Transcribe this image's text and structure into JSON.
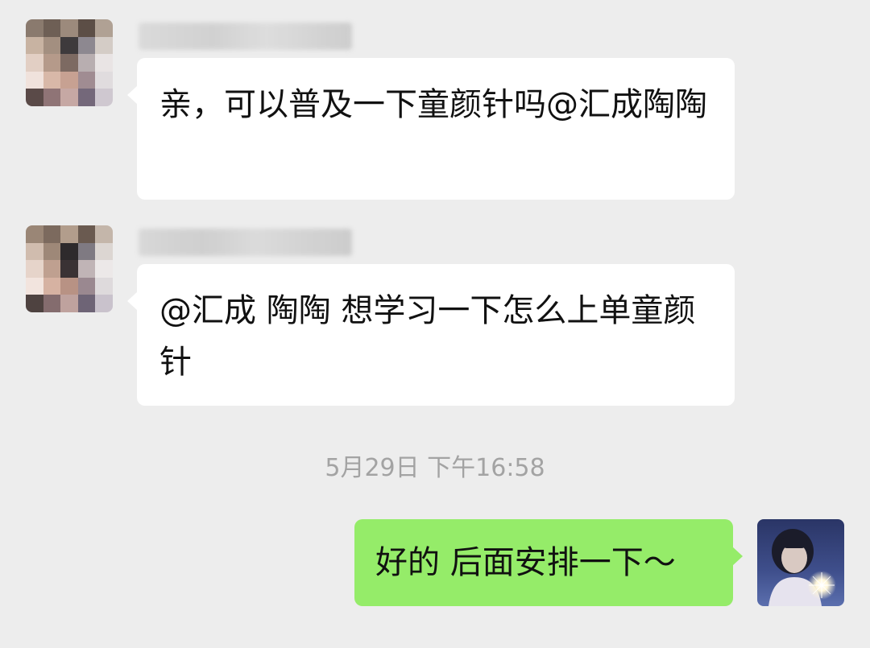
{
  "messages": [
    {
      "sender": "incoming",
      "text": "亲，可以普及一下童颜针吗@汇成陶陶"
    },
    {
      "sender": "incoming",
      "text": "@汇成 陶陶  想学习一下怎么上单童颜针"
    },
    {
      "sender": "outgoing",
      "text": "好的  后面安排一下～"
    }
  ],
  "timestamp": "5月29日 下午16:58",
  "colors": {
    "background": "#ededed",
    "incoming_bubble": "#ffffff",
    "outgoing_bubble": "#95ec69",
    "timestamp_text": "#a3a3a3"
  }
}
